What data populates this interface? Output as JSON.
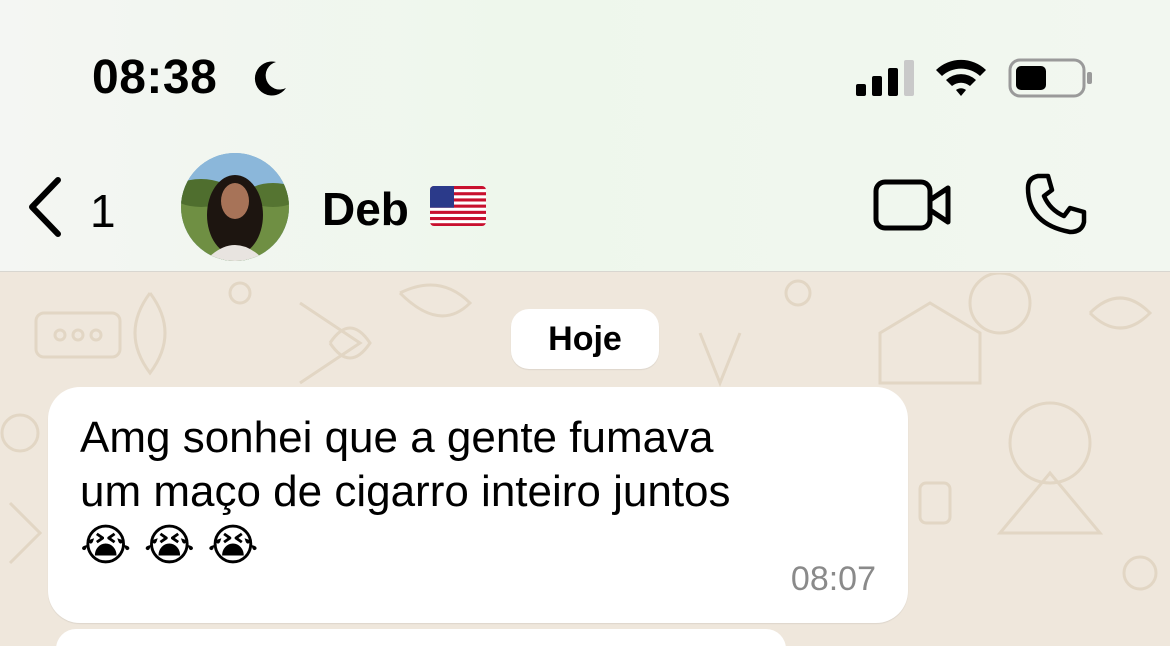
{
  "status_bar": {
    "time": "08:38",
    "icons": [
      "moon-icon",
      "signal-icon",
      "wifi-icon",
      "battery-icon"
    ]
  },
  "header": {
    "back_count": "1",
    "contact_name": "Deb",
    "flag": "flag-us-icon",
    "actions": [
      "video-call-icon",
      "phone-call-icon"
    ]
  },
  "chat": {
    "date_label": "Hoje",
    "messages": [
      {
        "text": "Amg sonhei que a gente fumava\num maço de cigarro inteiro juntos\n😭 😭 😭",
        "time": "08:07"
      }
    ]
  },
  "colors": {
    "chat_background": "#efe7dc",
    "bubble": "#ffffff",
    "timestamp": "#8a8a8a"
  }
}
